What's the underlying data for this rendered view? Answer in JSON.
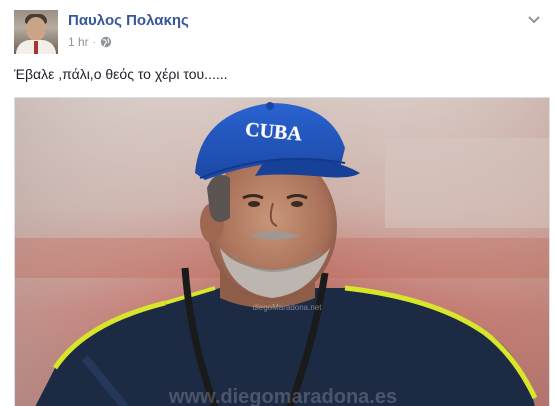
{
  "post": {
    "author": "Παυλος Πολακης",
    "time": "1 hr",
    "separator": "·",
    "privacy_icon": "globe-icon",
    "menu_icon": "chevron-down-icon",
    "text": "Έβαλε ,πάλι,ο θεός το χέρι του......",
    "image": {
      "cap_text": "CUBA",
      "watermark": "diegoMaradona.net",
      "bottom_watermark": "www.diegomaradona.es"
    }
  },
  "colors": {
    "author_link": "#365899",
    "meta_gray": "#90949c",
    "cap_blue": "#1f4fb5",
    "jersey_navy": "#1c2a44",
    "jersey_trim": "#d7e62a"
  }
}
